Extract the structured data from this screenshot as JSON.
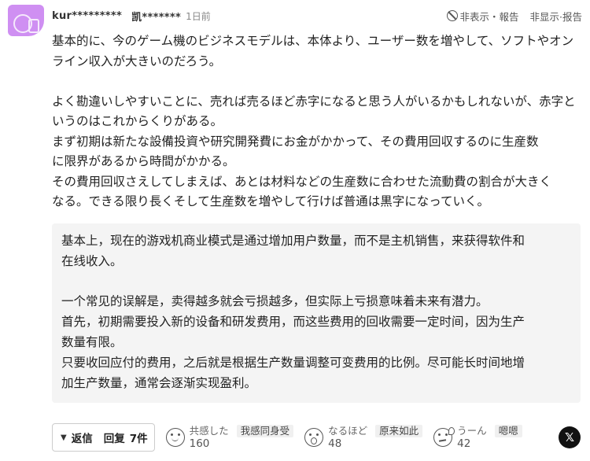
{
  "comment": {
    "username": "kur*********",
    "username_cn": "凯*******",
    "time": "1日前",
    "hide_label": "非表示・報告",
    "hide_label_cn": "非显示·报告",
    "body_lines": [
      "基本的に、今のゲーム機のビジネスモデルは、本体より、ユーザー数を増やして、ソフトやオン",
      "ライン収入が大きいのだろう。",
      "",
      "よく勘違いしやすいことに、売れば売るほど赤字になると思う人がいるかもしれないが、赤字と",
      "いうのはこれからくりがある。",
      "まず初期は新たな設備投資や研究開発費にお金がかかって、その費用回収するのに生産数",
      "に限界があるから時間がかかる。",
      "その費用回収さえしてしまえば、あとは材料などの生産数に合わせた流動費の割合が大きく",
      "なる。できる限り長くそして生産数を増やして行けば普通は黒字になっていく。"
    ],
    "translation_lines": [
      "基本上，现在的游戏机商业模式是通过增加用户数量，而不是主机销售，来获得软件和",
      "在线收入。",
      "",
      "一个常见的误解是，卖得越多就会亏损越多，但实际上亏损意味着未来有潜力。",
      "首先，初期需要投入新的设备和研发费用，而这些费用的回收需要一定时间，因为生产",
      "数量有限。",
      "只要收回应付的费用，之后就是根据生产数量调整可变费用的比例。尽可能长时间地增",
      "加生产数量，通常会逐渐实现盈利。"
    ]
  },
  "footer": {
    "reply_label": "返信",
    "reply_label_cn": "回复",
    "reply_count": "7件",
    "reactions": [
      {
        "icon": "smile-face-icon",
        "name": "共感した",
        "name_cn": "我感同身受",
        "count": "160"
      },
      {
        "icon": "surprised-face-icon",
        "name": "なるほど",
        "name_cn": "原来如此",
        "count": "48"
      },
      {
        "icon": "thinking-face-icon",
        "name": "うーん",
        "name_cn": "嗯嗯",
        "count": "42"
      }
    ],
    "share_icon": "x-share-icon",
    "share_label": "𝕏"
  }
}
